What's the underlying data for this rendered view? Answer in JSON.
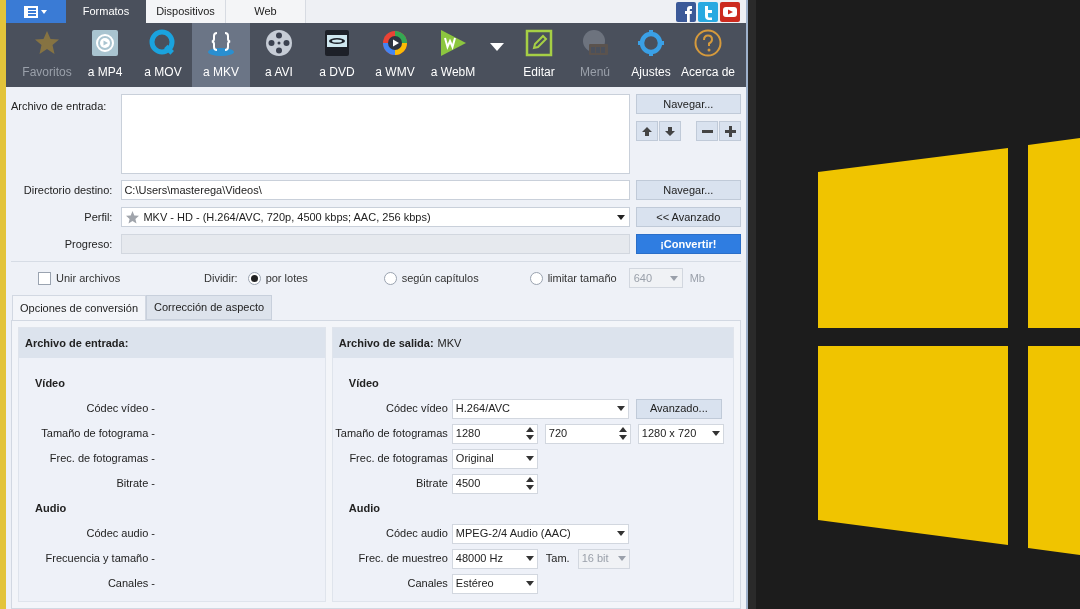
{
  "tabs": [
    {
      "label": "Formatos",
      "selected": true
    },
    {
      "label": "Dispositivos",
      "selected": false
    },
    {
      "label": "Web",
      "selected": false
    }
  ],
  "toolbar": {
    "formats": [
      {
        "label": "Favoritos",
        "selected": false,
        "disabled": true
      },
      {
        "label": "a MP4",
        "selected": false,
        "disabled": false
      },
      {
        "label": "a MOV",
        "selected": false,
        "disabled": false
      },
      {
        "label": "a MKV",
        "selected": true,
        "disabled": false
      },
      {
        "label": "a AVI",
        "selected": false,
        "disabled": false
      },
      {
        "label": "a DVD",
        "selected": false,
        "disabled": false
      },
      {
        "label": "a WMV",
        "selected": false,
        "disabled": false
      },
      {
        "label": "a WebM",
        "selected": false,
        "disabled": false
      }
    ],
    "tools": [
      {
        "label": "Editar",
        "disabled": false
      },
      {
        "label": "Menú",
        "disabled": true
      },
      {
        "label": "Ajustes",
        "disabled": false
      },
      {
        "label": "Acerca de",
        "disabled": false
      }
    ]
  },
  "input_files": {
    "label": "Archivo de entrada:",
    "button": "Navegar..."
  },
  "output_dir": {
    "label": "Directorio destino:",
    "value": "C:\\Users\\masterega\\Videos\\",
    "button": "Navegar..."
  },
  "profile": {
    "label": "Perfil:",
    "value": "MKV - HD - (H.264/AVC, 720p, 4500 kbps; AAC, 256 kbps)",
    "button": "<< Avanzado"
  },
  "progress": {
    "label": "Progreso:",
    "level": 0,
    "button": "¡Convertir!"
  },
  "join_files": {
    "label": "Unir archivos",
    "checked": false
  },
  "split": {
    "label": "Dividir:",
    "options": [
      {
        "label": "por lotes",
        "selected": true
      },
      {
        "label": "según capítulos",
        "selected": false
      },
      {
        "label": "limitar tamaño",
        "selected": false
      }
    ],
    "size_value": "640",
    "size_unit": "Mb",
    "size_disabled": true
  },
  "sub_tabs": [
    {
      "label": "Opciones de conversión",
      "selected": true
    },
    {
      "label": "Corrección de aspecto",
      "selected": false
    }
  ],
  "input_panel": {
    "title": "Archivo de entrada:",
    "sections": [
      {
        "title": "Vídeo",
        "rows": [
          {
            "text": "Códec vídeo -"
          },
          {
            "text": "Tamaño de fotograma -"
          },
          {
            "text": "Frec. de fotogramas -"
          },
          {
            "text": "Bitrate -"
          }
        ]
      },
      {
        "title": "Audio",
        "rows": [
          {
            "text": "Códec audio -"
          },
          {
            "text": "Frecuencia y tamaño -"
          },
          {
            "text": "Canales -"
          }
        ]
      }
    ]
  },
  "output_panel": {
    "title": "Archivo de salida:",
    "format": "MKV",
    "sections": [
      {
        "title": "Vídeo",
        "rows": [
          {
            "label": "Códec vídeo",
            "fields": [
              {
                "kind": "combo_wide",
                "value": "H.264/AVC"
              },
              {
                "kind": "button",
                "value": "Avanzado..."
              }
            ]
          },
          {
            "label": "Tamaño de fotogramas",
            "fields": [
              {
                "kind": "spin",
                "value": "1280"
              },
              {
                "kind": "spin",
                "value": "720"
              },
              {
                "kind": "combo",
                "value": "1280 x 720"
              }
            ]
          },
          {
            "label": "Frec. de fotogramas",
            "fields": [
              {
                "kind": "combo",
                "value": "Original"
              }
            ]
          },
          {
            "label": "Bitrate",
            "fields": [
              {
                "kind": "spin",
                "value": "4500"
              }
            ]
          }
        ]
      },
      {
        "title": "Audio",
        "rows": [
          {
            "label": "Códec audio",
            "fields": [
              {
                "kind": "combo_wide",
                "value": "MPEG-2/4 Audio (AAC)"
              }
            ]
          },
          {
            "label": "Frec. de muestreo",
            "fields": [
              {
                "kind": "combo",
                "value": "48000 Hz"
              },
              {
                "kind": "label",
                "value": "Tam."
              },
              {
                "kind": "combo_small",
                "value": "16 bit",
                "disabled": true
              }
            ]
          },
          {
            "label": "Canales",
            "fields": [
              {
                "kind": "combo",
                "value": "Estéreo"
              }
            ]
          }
        ]
      }
    ]
  }
}
